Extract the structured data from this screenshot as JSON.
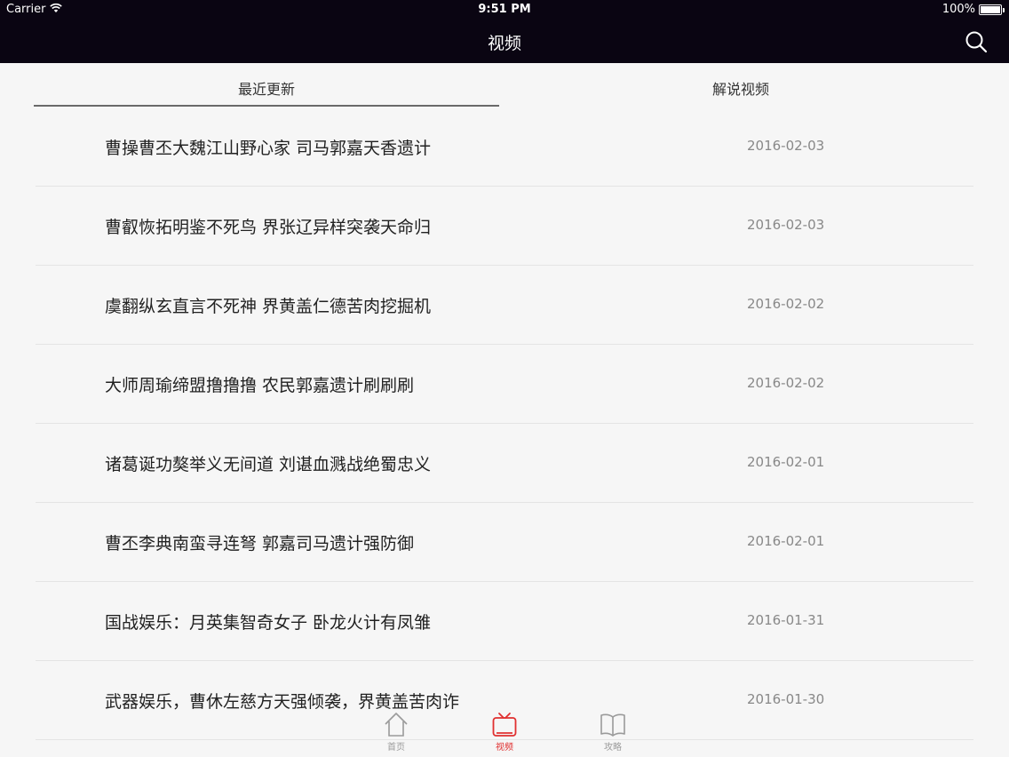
{
  "status_bar": {
    "carrier": "Carrier",
    "time": "9:51 PM",
    "battery": "100%"
  },
  "nav": {
    "title": "视频",
    "search_icon": "search-icon"
  },
  "tabs": [
    {
      "label": "最近更新",
      "selected": true
    },
    {
      "label": "解说视频",
      "selected": false
    }
  ],
  "videos": [
    {
      "title": "曹操曹丕大魏江山野心家 司马郭嘉天香遗计",
      "date": "2016-02-03"
    },
    {
      "title": "曹叡恢拓明鉴不死鸟 界张辽异样突袭天命归",
      "date": "2016-02-03"
    },
    {
      "title": "虞翻纵玄直言不死神 界黄盖仁德苦肉挖掘机",
      "date": "2016-02-02"
    },
    {
      "title": "大师周瑜缔盟撸撸撸 农民郭嘉遗计刷刷刷",
      "date": "2016-02-02"
    },
    {
      "title": "诸葛诞功獒举义无间道 刘谌血溅战绝蜀忠义",
      "date": "2016-02-01"
    },
    {
      "title": "曹丕李典南蛮寻连弩 郭嘉司马遗计强防御",
      "date": "2016-02-01"
    },
    {
      "title": "国战娱乐：月英集智奇女子 卧龙火计有凤雏",
      "date": "2016-01-31"
    },
    {
      "title": "武器娱乐，曹休左慈方天强倾袭，界黄盖苦肉诈",
      "date": "2016-01-30"
    }
  ],
  "tabbar": [
    {
      "label": "首页",
      "icon": "home-icon",
      "selected": false
    },
    {
      "label": "视频",
      "icon": "tv-icon",
      "selected": true
    },
    {
      "label": "攻略",
      "icon": "book-icon",
      "selected": false
    }
  ],
  "colors": {
    "nav_bg": "#0a0512",
    "accent": "#e03030",
    "background": "#f6f6f6"
  }
}
